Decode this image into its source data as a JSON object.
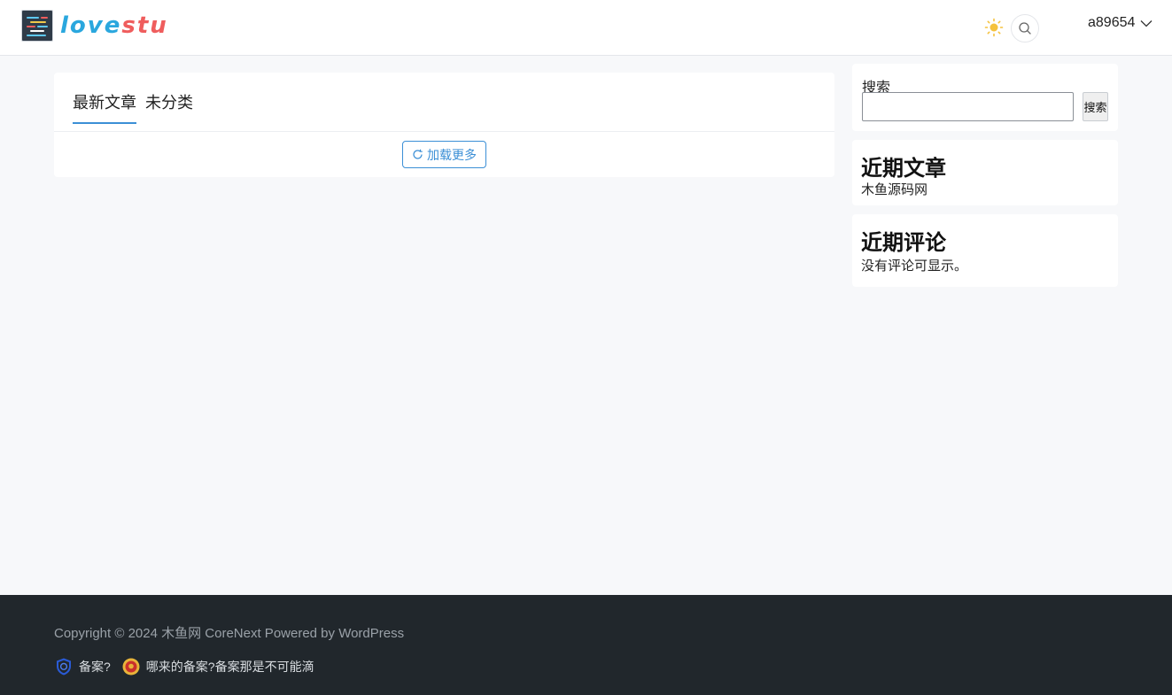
{
  "header": {
    "logo_part1": "love",
    "logo_part2": "stu",
    "username": "a89654"
  },
  "main": {
    "tabs": [
      {
        "label": "最新文章",
        "active": true
      },
      {
        "label": "未分类",
        "active": false
      }
    ],
    "load_more": "加载更多"
  },
  "sidebar": {
    "search": {
      "label": "搜索",
      "button": "搜索",
      "value": ""
    },
    "recent_posts": {
      "title": "近期文章",
      "items": [
        "木鱼源码网"
      ]
    },
    "recent_comments": {
      "title": "近期评论",
      "empty": "没有评论可显示。"
    }
  },
  "footer": {
    "copyright": "Copyright © 2024 木鱼网 CoreNext Powered by WordPress",
    "beian1": "备案?",
    "beian2": "哪来的备案?备案那是不可能滴"
  },
  "colors": {
    "accent": "#3b8fd6",
    "logo_blue": "#2aa7de",
    "logo_red": "#ef5d5d",
    "footer_bg": "#21272c",
    "page_bg": "#f7f8fa"
  },
  "icons": [
    "logo-icon",
    "sun-icon",
    "search-icon",
    "chevron-down-icon",
    "refresh-icon",
    "shield-icon",
    "police-badge-icon"
  ]
}
